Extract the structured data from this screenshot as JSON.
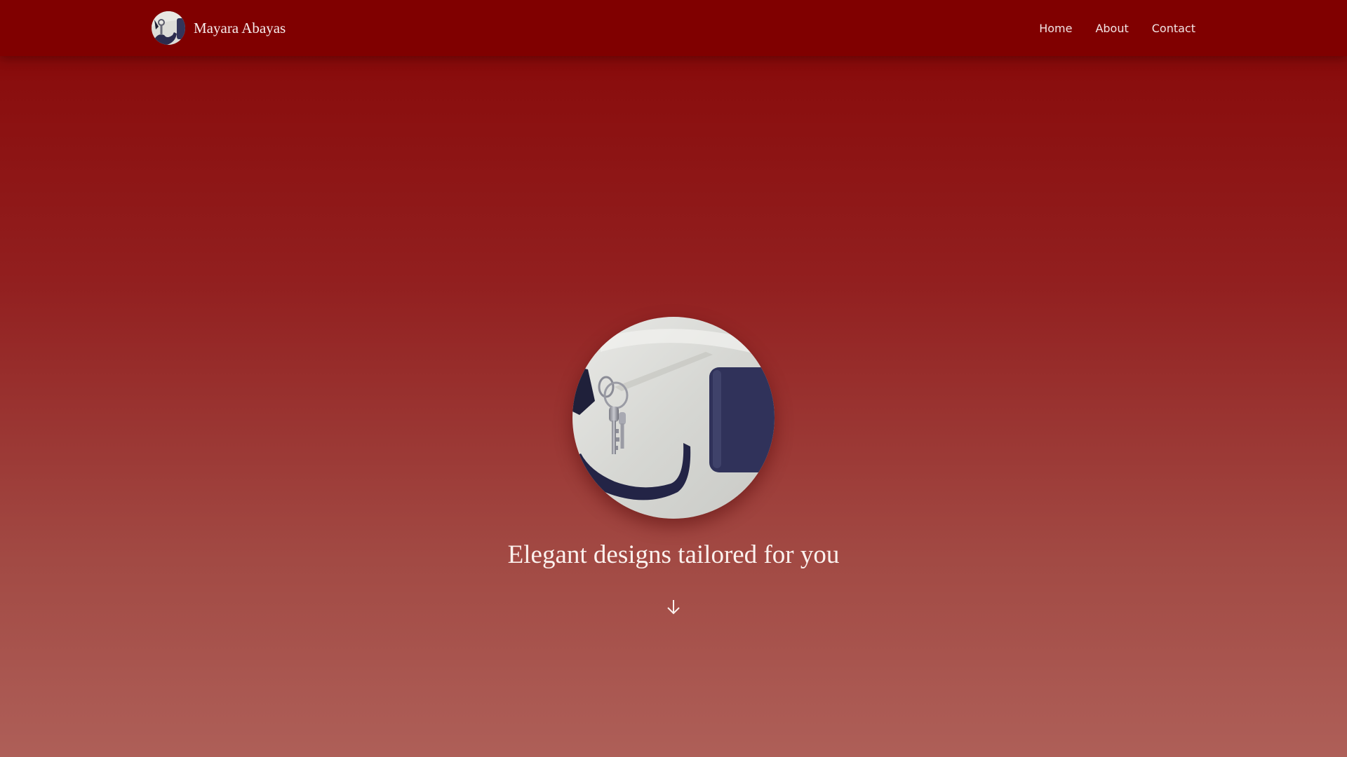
{
  "brand": {
    "name": "Mayara Abayas",
    "logo_icon": "keys-on-door-logo"
  },
  "nav": {
    "items": [
      {
        "label": "Home"
      },
      {
        "label": "About"
      },
      {
        "label": "Contact"
      }
    ]
  },
  "hero": {
    "image_icon": "keys-in-door-photo",
    "tagline": "Elegant designs tailored for you",
    "scroll_icon": "arrow-down-icon"
  },
  "colors": {
    "navbar": "#800000",
    "gradient_top": "#8a0e0e",
    "gradient_bottom": "#ae5f58",
    "text": "#f6ecec"
  }
}
